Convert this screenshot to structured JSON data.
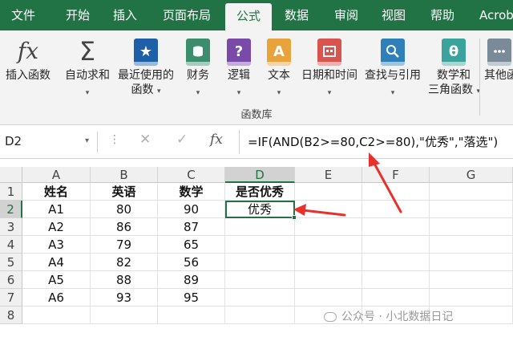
{
  "ribbon_tabs": [
    "文件",
    "开始",
    "插入",
    "页面布局",
    "公式",
    "数据",
    "审阅",
    "视图",
    "帮助",
    "Acrob"
  ],
  "active_tab": "公式",
  "ribbon": {
    "insert_function": {
      "icon": "fx",
      "label": "插入函数"
    },
    "autosum": {
      "icon": "Σ",
      "label": "自动求和"
    },
    "recent": {
      "icon": "★",
      "line1": "最近使用的",
      "line2": "函数"
    },
    "financial": {
      "label": "财务"
    },
    "logical": {
      "icon": "?",
      "label": "逻辑"
    },
    "text": {
      "icon": "A",
      "label": "文本"
    },
    "datetime": {
      "label": "日期和时间"
    },
    "lookup": {
      "label": "查找与引用"
    },
    "math": {
      "icon": "θ",
      "line1": "数学和",
      "line2": "三角函数"
    },
    "other": {
      "line1": "其他函"
    },
    "group_label": "函数库",
    "caret": "▾"
  },
  "formula_bar": {
    "name_box": "D2",
    "fx": "fx",
    "cancel": "✕",
    "enter": "✓",
    "dots": "⋮",
    "formula": "=IF(AND(B2>=80,C2>=80),\"优秀\",\"落选\")"
  },
  "columns": [
    "A",
    "B",
    "C",
    "D",
    "E",
    "F",
    "G"
  ],
  "active_column": "D",
  "rows": [
    "1",
    "2",
    "3",
    "4",
    "5",
    "6",
    "7",
    "8"
  ],
  "active_row": "2",
  "active_cell": "D2",
  "sheet": [
    [
      "姓名",
      "英语",
      "数学",
      "是否优秀",
      "",
      "",
      ""
    ],
    [
      "A1",
      "80",
      "90",
      "优秀",
      "",
      "",
      ""
    ],
    [
      "A2",
      "86",
      "87",
      "",
      "",
      "",
      ""
    ],
    [
      "A3",
      "79",
      "65",
      "",
      "",
      "",
      ""
    ],
    [
      "A4",
      "82",
      "56",
      "",
      "",
      "",
      ""
    ],
    [
      "A5",
      "88",
      "89",
      "",
      "",
      "",
      ""
    ],
    [
      "A6",
      "93",
      "95",
      "",
      "",
      "",
      ""
    ],
    [
      "",
      "",
      "",
      "",
      "",
      "",
      ""
    ]
  ],
  "watermark": "公众号 · 小北数据日记",
  "colors": {
    "brand": "#217346",
    "arrow": "#e8312a",
    "financial_icon": "#3c8d6e",
    "logical_icon": "#7a4aa8",
    "text_icon": "#e8a33c",
    "datetime_icon": "#d9534f",
    "lookup_icon": "#2f7fb8",
    "math_icon": "#3aa39b",
    "recent_icon": "#1f5fa8"
  }
}
